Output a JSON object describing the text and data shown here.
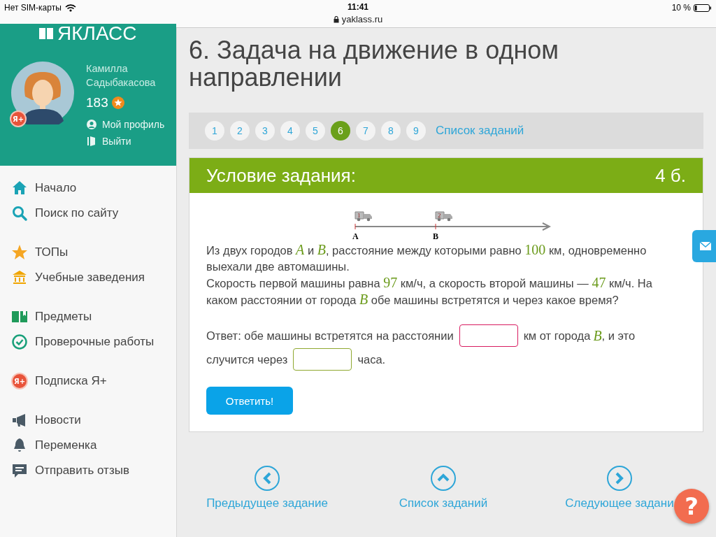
{
  "status_bar": {
    "carrier": "Нет SIM-карты",
    "time": "11:41",
    "url": "yaklass.ru",
    "battery": "10 %"
  },
  "sidebar": {
    "logo": "ЯКЛАСС",
    "user": {
      "first_name": "Камилла",
      "last_name": "Садыбакасова",
      "badge": "Я+",
      "points": "183",
      "links": [
        {
          "kind": "profile",
          "label": "Мой профиль"
        },
        {
          "kind": "exit",
          "label": "Выйти"
        }
      ]
    },
    "menu": [
      [
        {
          "kind": "home",
          "label": "Начало"
        },
        {
          "kind": "search",
          "label": "Поиск по сайту"
        }
      ],
      [
        {
          "kind": "star",
          "label": "ТОПы"
        },
        {
          "kind": "school",
          "label": "Учебные заведения"
        }
      ],
      [
        {
          "kind": "book",
          "label": "Предметы"
        },
        {
          "kind": "check",
          "label": "Проверочные работы"
        }
      ],
      [
        {
          "kind": "yaplus",
          "label": "Подписка Я+",
          "badge": "Я+"
        }
      ],
      [
        {
          "kind": "megaphone",
          "label": "Новости"
        },
        {
          "kind": "bell",
          "label": "Переменка"
        },
        {
          "kind": "comment",
          "label": "Отправить отзыв"
        }
      ]
    ]
  },
  "title": "6. Задача на движение в одном направлении",
  "pagination": {
    "pages": [
      {
        "label": "1",
        "selected": false
      },
      {
        "label": "2",
        "selected": false
      },
      {
        "label": "3",
        "selected": false
      },
      {
        "label": "4",
        "selected": false
      },
      {
        "label": "5",
        "selected": false
      },
      {
        "label": "6",
        "selected": true
      },
      {
        "label": "7",
        "selected": false
      },
      {
        "label": "8",
        "selected": false
      },
      {
        "label": "9",
        "selected": false
      }
    ],
    "list_link": "Список заданий"
  },
  "task": {
    "header": "Условие задания:",
    "points": "4 б.",
    "diagram": {
      "cars": [
        "1",
        "2"
      ],
      "points": [
        "A",
        "B"
      ]
    },
    "paragraphs": [
      [
        {
          "kind": "text",
          "text": "Из двух городов "
        },
        {
          "kind": "math",
          "text": "A"
        },
        {
          "kind": "text",
          "text": " и "
        },
        {
          "kind": "math",
          "text": "B"
        },
        {
          "kind": "text",
          "text": ", расстояние между которыми равно "
        },
        {
          "kind": "math",
          "text": "100"
        },
        {
          "kind": "text",
          "text": " км, одновременно выехали две автомашины."
        }
      ],
      [
        {
          "kind": "text",
          "text": "Скорость первой машины равна "
        },
        {
          "kind": "math",
          "text": "97"
        },
        {
          "kind": "text",
          "text": " км/ч, а скорость второй машины — "
        },
        {
          "kind": "math",
          "text": "47"
        },
        {
          "kind": "text",
          "text": " км/ч. На каком расстоянии от города "
        },
        {
          "kind": "math",
          "text": "B"
        },
        {
          "kind": "text",
          "text": " обе машины встретятся и через какое время?"
        }
      ]
    ],
    "answer": [
      {
        "kind": "text",
        "text": "Ответ: обе машины встретятся на расстоянии"
      },
      {
        "kind": "field",
        "focused": true
      },
      {
        "kind": "text",
        "text": "км от города"
      },
      {
        "kind": "math",
        "text": "B"
      },
      {
        "kind": "text",
        "text": ", и это"
      },
      {
        "kind": "break"
      },
      {
        "kind": "text",
        "text": "случится через"
      },
      {
        "kind": "field",
        "focused": false
      },
      {
        "kind": "text",
        "text": "часа."
      }
    ],
    "submit": "Ответить!"
  },
  "nav": [
    {
      "kind": "left",
      "label": "Предыдущее задание"
    },
    {
      "kind": "up",
      "label": "Список заданий"
    },
    {
      "kind": "right",
      "label": "Следующее задани"
    }
  ],
  "help_button": "?"
}
